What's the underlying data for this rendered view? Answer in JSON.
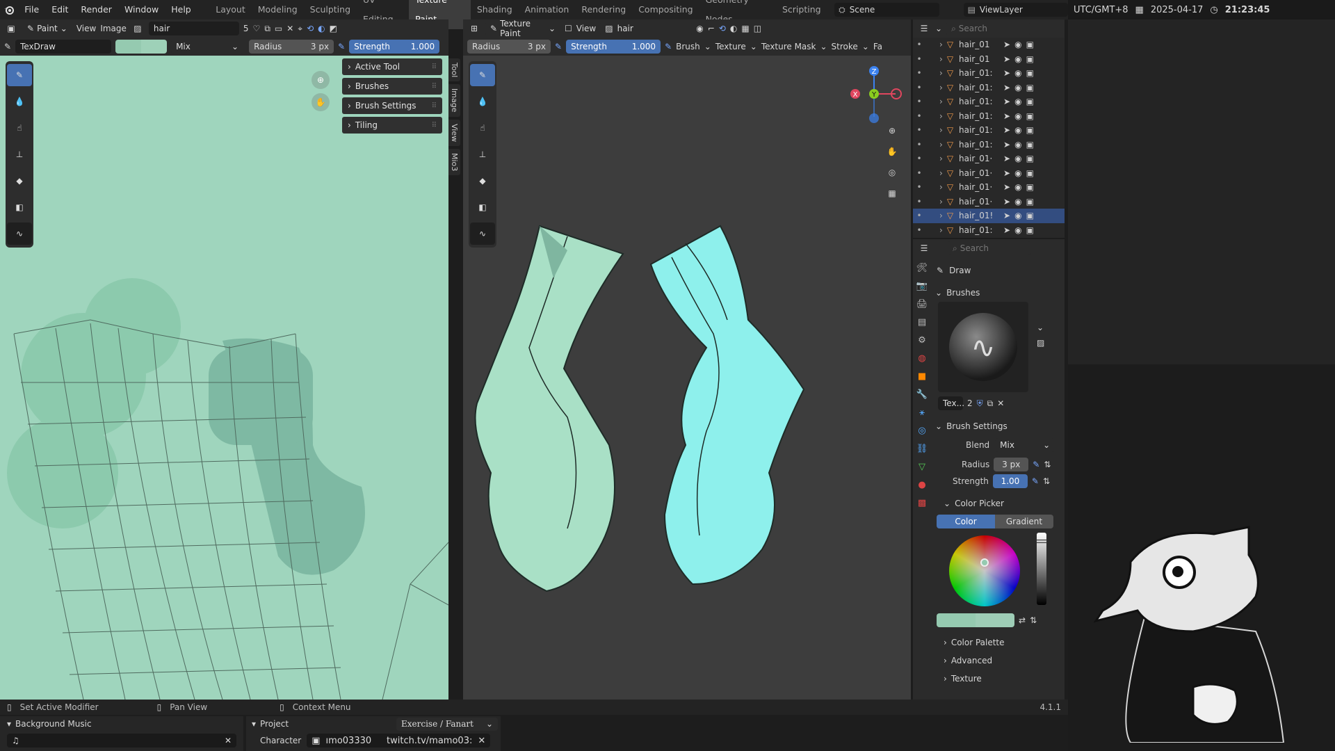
{
  "menubar": {
    "items": [
      "File",
      "Edit",
      "Render",
      "Window",
      "Help"
    ],
    "tabs": [
      "Layout",
      "Modeling",
      "Sculpting",
      "UV Editing",
      "Texture Paint",
      "Shading",
      "Animation",
      "Rendering",
      "Compositing",
      "Geometry Nodes",
      "Scripting"
    ],
    "active_tab": "Texture Paint",
    "scene": "Scene",
    "view_layer": "ViewLayer"
  },
  "clock": {
    "tz": "UTC/GMT+8",
    "date": "2025-04-17",
    "time": "21:23:45"
  },
  "image_editor": {
    "mode": "Paint",
    "view": "View",
    "image_menu": "Image",
    "image_name": "hair",
    "users": "5",
    "brush_name": "TexDraw",
    "blend": "Mix",
    "radius_label": "Radius",
    "radius": "3 px",
    "strength_label": "Strength",
    "strength": "1.000",
    "panels": [
      "Active Tool",
      "Brushes",
      "Brush Settings",
      "Tiling"
    ],
    "side_tabs": [
      "Tool",
      "Image",
      "View",
      "Mio3"
    ]
  },
  "viewport": {
    "mode": "Texture Paint",
    "view": "View",
    "object": "hair",
    "radius_label": "Radius",
    "radius": "3 px",
    "strength_label": "Strength",
    "strength": "1.000",
    "menus": [
      "Brush",
      "Texture",
      "Texture Mask",
      "Stroke",
      "Fa"
    ],
    "gizmo": {
      "z": "Z",
      "y": "Y",
      "x": "X"
    }
  },
  "outliner": {
    "search_placeholder": "Search",
    "rows": [
      "hair_01",
      "hair_01",
      "hair_01:",
      "hair_01:",
      "hair_01:",
      "hair_01:",
      "hair_01:",
      "hair_01:",
      "hair_01·",
      "hair_01·",
      "hair_01·",
      "hair_01·",
      "hair_01!",
      "hair_01:"
    ],
    "selected_index": 12
  },
  "properties": {
    "search_placeholder": "Search",
    "tool_name": "Draw",
    "brushes_title": "Brushes",
    "brush_short": "Tex...",
    "brush_users": "2",
    "brush_settings_title": "Brush Settings",
    "blend_label": "Blend",
    "blend": "Mix",
    "radius_label": "Radius",
    "radius": "3 px",
    "strength_label": "Strength",
    "strength": "1.00",
    "color_picker_title": "Color Picker",
    "tab_color": "Color",
    "tab_gradient": "Gradient",
    "color_palette": "Color Palette",
    "advanced": "Advanced",
    "texture": "Texture",
    "version": "4.1.1"
  },
  "statusbar": {
    "set_modifier": "Set Active Modifier",
    "pan": "Pan View",
    "context": "Context Menu"
  },
  "bottom_panels": {
    "music_title": "Background Music",
    "project_title": "Project",
    "project_value": "Exercise / Fanart",
    "character_label": "Character",
    "character_name": "ımo03330",
    "character_link": "twitch.tv/mamo03:"
  },
  "colors": {
    "accent": "#4772b3",
    "paint": "#95cab0",
    "canvas": "#9fd5bd",
    "hair_left": "#a9e0c6",
    "hair_right": "#8ef0ec"
  }
}
